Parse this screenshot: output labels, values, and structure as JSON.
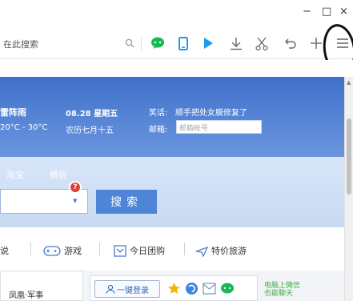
{
  "window": {
    "minimize_glyph": "−",
    "maximize_glyph": "□",
    "close_glyph": "×"
  },
  "toolbar": {
    "search_placeholder": "在此搜索",
    "icons": [
      "search-icon",
      "wechat-icon",
      "phone-icon",
      "play-icon",
      "download-icon",
      "screenshot-icon",
      "undo-icon",
      "new-tab-icon",
      "menu-icon"
    ],
    "accent_color": "#1a9bf0"
  },
  "banner": {
    "weather": "雷阵雨",
    "temperature": "20°C - 30°C",
    "date": "08.28 星期五",
    "lunar": "农历七月十五",
    "joke_label": "笑话:",
    "joke_text": "顺手把处女膜修复了",
    "mail_label": "邮箱:",
    "mail_placeholder": "邮箱帐号"
  },
  "search_panel": {
    "tabs": [
      "淘宝",
      "微信"
    ],
    "badge": "?",
    "search_button": "搜索",
    "dropdown_glyph": "▼"
  },
  "nav": {
    "items": [
      {
        "label": "说",
        "icon": ""
      },
      {
        "label": "游戏",
        "icon": "gamepad-icon"
      },
      {
        "label": "今日团购",
        "icon": "cart-icon"
      },
      {
        "label": "特价旅游",
        "icon": "plane-icon"
      }
    ]
  },
  "bottom": {
    "fenghuang": "凤凰·军事",
    "login_label": "一键登录",
    "wechat_tip_line1": "电脑上微信",
    "wechat_tip_line2": "也能聊天"
  }
}
